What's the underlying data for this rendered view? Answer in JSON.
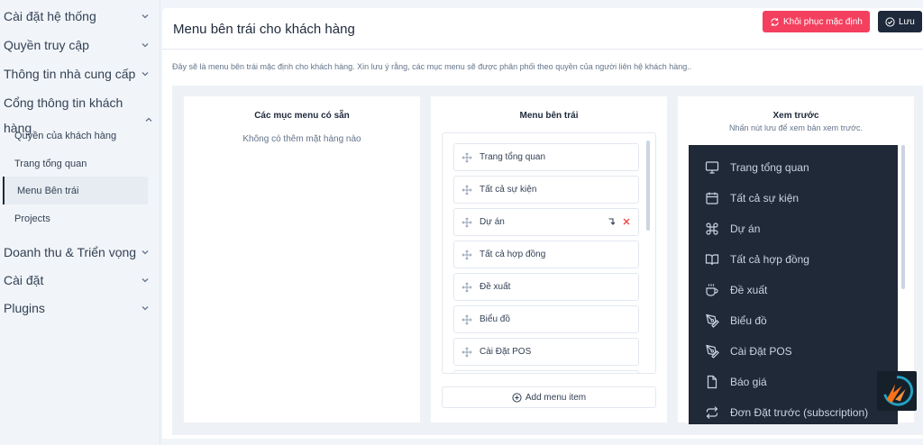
{
  "sidebar": {
    "items": [
      {
        "label": "Cài đặt hệ thống"
      },
      {
        "label": "Quyền truy cập"
      },
      {
        "label": "Thông tin nhà cung cấp"
      },
      {
        "label": "Cổng thông tin khách hàng"
      }
    ],
    "subitems": [
      {
        "label": "Quyền của khách hàng"
      },
      {
        "label": "Trang tổng quan"
      },
      {
        "label": "Menu Bên trái",
        "active": true
      },
      {
        "label": "Projects"
      }
    ],
    "after": [
      {
        "label": "Doanh thu & Triển vọng"
      },
      {
        "label": "Cài đặt"
      },
      {
        "label": "Plugins"
      }
    ]
  },
  "header": {
    "title": "Menu bên trái cho khách hàng",
    "reset_label": "Khôi phục mặc định",
    "save_label": "Lưu"
  },
  "description": "Đây sẽ là menu bên trái mặc định cho khách hàng. Xin lưu ý rằng, các mục menu sẽ được phân phối theo quyền của người liên hệ khách hàng..",
  "available": {
    "title": "Các mục menu có sẵn",
    "empty": "Không có thêm mặt hàng nào"
  },
  "left_menu": {
    "title": "Menu bên trái",
    "items": [
      "Trang tổng quan",
      "Tất cả sự kiện",
      "Dự án",
      "Tất cả hợp đồng",
      "Đề xuất",
      "Biểu đồ",
      "Cài Đặt POS"
    ],
    "add_label": "Add menu item"
  },
  "preview": {
    "title": "Xem trước",
    "subtitle": "Nhấn nút lưu để xem bản xem trước.",
    "items": [
      {
        "label": "Trang tổng quan",
        "icon": "monitor-icon"
      },
      {
        "label": "Tất cả sự kiện",
        "icon": "calendar-icon"
      },
      {
        "label": "Dự án",
        "icon": "command-icon"
      },
      {
        "label": "Tất cả hợp đồng",
        "icon": "book-open-icon"
      },
      {
        "label": "Đề xuất",
        "icon": "coffee-icon"
      },
      {
        "label": "Biểu đồ",
        "icon": "pen-tool-icon"
      },
      {
        "label": "Cài Đặt POS",
        "icon": "pen-tool-icon"
      },
      {
        "label": "Báo giá",
        "icon": "file-icon"
      },
      {
        "label": "Đơn Đặt trước (subscription)",
        "icon": "repeat-icon"
      }
    ]
  },
  "colors": {
    "danger": "#f43f5e",
    "dark": "#1e293b",
    "preview_bg": "#1f2937"
  }
}
